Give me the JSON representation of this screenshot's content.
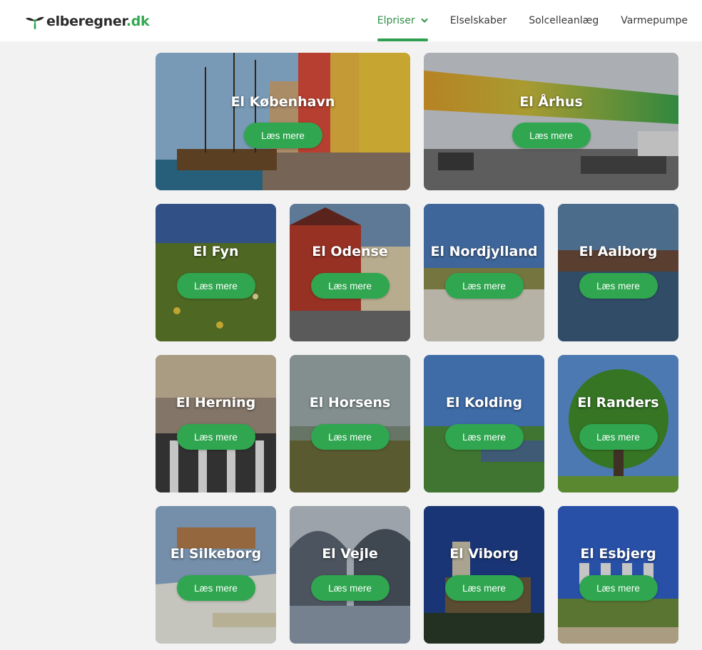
{
  "brand": {
    "name": "elberegner",
    "tld": ".dk",
    "accent": "#33a852"
  },
  "nav": {
    "items": [
      {
        "label": "Elpriser",
        "active": true,
        "has_dropdown": true
      },
      {
        "label": "Elselskaber"
      },
      {
        "label": "Solcelleanlæg"
      },
      {
        "label": "Varmepumpe"
      }
    ]
  },
  "cards": [
    {
      "title": "El København",
      "button": "Læs mere",
      "icon": "city-photo"
    },
    {
      "title": "El Århus",
      "button": "Læs mere",
      "icon": "city-photo"
    },
    {
      "title": "El Fyn",
      "button": "Læs mere",
      "icon": "city-photo"
    },
    {
      "title": "El Odense",
      "button": "Læs mere",
      "icon": "city-photo"
    },
    {
      "title": "El Nordjylland",
      "button": "Læs mere",
      "icon": "city-photo"
    },
    {
      "title": "El Aalborg",
      "button": "Læs mere",
      "icon": "city-photo"
    },
    {
      "title": "El Herning",
      "button": "Læs mere",
      "icon": "city-photo"
    },
    {
      "title": "El Horsens",
      "button": "Læs mere",
      "icon": "city-photo"
    },
    {
      "title": "El Kolding",
      "button": "Læs mere",
      "icon": "city-photo"
    },
    {
      "title": "El Randers",
      "button": "Læs mere",
      "icon": "city-photo"
    },
    {
      "title": "El Silkeborg",
      "button": "Læs mere",
      "icon": "city-photo"
    },
    {
      "title": "El Vejle",
      "button": "Læs mere",
      "icon": "city-photo"
    },
    {
      "title": "El Viborg",
      "button": "Læs mere",
      "icon": "city-photo"
    },
    {
      "title": "El Esbjerg",
      "button": "Læs mere",
      "icon": "city-photo"
    }
  ]
}
